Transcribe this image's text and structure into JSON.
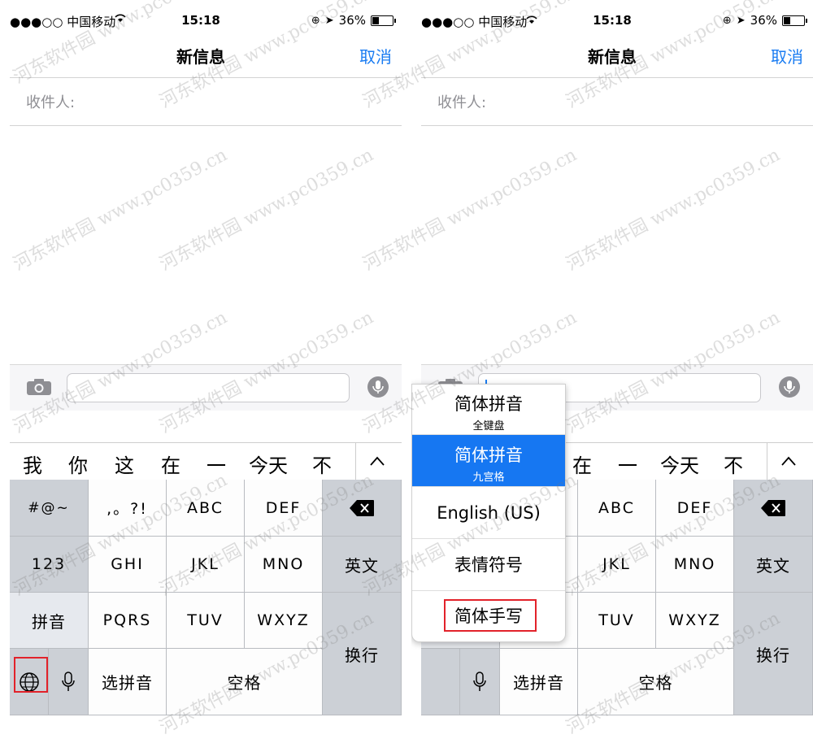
{
  "status": {
    "carrier": "●●●○○ 中国移动",
    "time": "15:18",
    "battery": "36%",
    "battery_level": 0.36
  },
  "nav": {
    "title": "新信息",
    "cancel": "取消"
  },
  "recipient_label": "收件人:",
  "candidates": [
    "我",
    "你",
    "这",
    "在",
    "一",
    "今天",
    "不"
  ],
  "keyboard": {
    "symbols": "#@~",
    "punct": ",。?!",
    "abc": "ABC",
    "def": "DEF",
    "num": "123",
    "ghi": "GHI",
    "jkl": "JKL",
    "mno": "MNO",
    "english": "英文",
    "pinyin": "拼音",
    "pqrs": "PQRS",
    "tuv": "TUV",
    "wxyz": "WXYZ",
    "return": "换行",
    "select_pinyin": "选拼音",
    "space": "空格"
  },
  "popup": [
    {
      "main": "简体拼音",
      "sub": "全键盘",
      "selected": false
    },
    {
      "main": "简体拼音",
      "sub": "九宫格",
      "selected": true
    },
    {
      "main": "English (US)",
      "sub": "",
      "selected": false
    },
    {
      "main": "表情符号",
      "sub": "",
      "selected": false
    },
    {
      "main": "简体手写",
      "sub": "",
      "selected": false
    }
  ],
  "watermark": [
    "河东软件园",
    "www.pc0359.cn"
  ],
  "colors": {
    "accent": "#1a7cf2",
    "highlight": "#e2222a",
    "selected": "#1677f2"
  }
}
